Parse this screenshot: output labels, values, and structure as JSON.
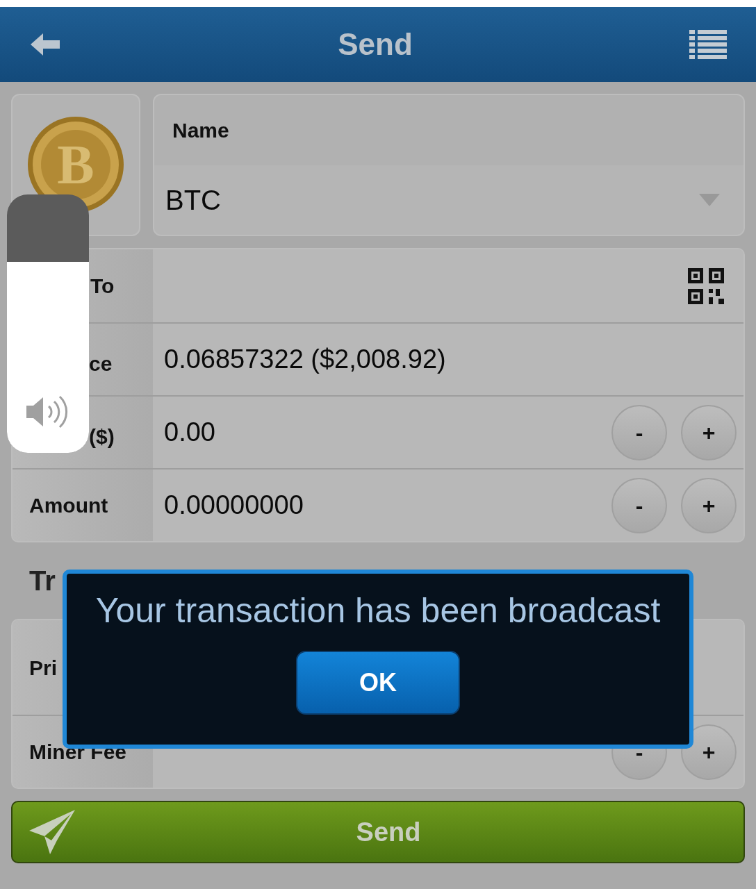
{
  "header": {
    "title": "Send"
  },
  "currency": {
    "label": "Name",
    "value": "BTC",
    "coin_symbol": "B"
  },
  "fields": [
    {
      "kind": "qr",
      "label": "To"
    },
    {
      "kind": "text",
      "label": "ce",
      "value": "0.06857322 ($2,008.92)"
    },
    {
      "kind": "stepper",
      "label": "($)",
      "value": "0.00",
      "minus": "-",
      "plus": "+"
    },
    {
      "kind": "stepper",
      "label": "Amount",
      "value": "0.00000000",
      "minus": "-",
      "plus": "+"
    }
  ],
  "section": {
    "title": "Tr"
  },
  "fee_fields": [
    {
      "kind": "priority",
      "label": "Pri"
    },
    {
      "kind": "stepper",
      "label": "Miner Fee",
      "minus": "-",
      "plus": "+"
    }
  ],
  "send_button": {
    "label": "Send"
  },
  "dialog": {
    "message": "Your transaction has been broadcast",
    "button": "OK"
  },
  "volume": {
    "level": 0.74
  }
}
